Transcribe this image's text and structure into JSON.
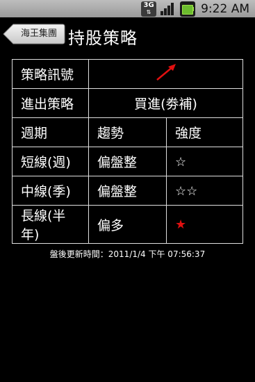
{
  "status_bar": {
    "network_label": "3G",
    "time": "9:22 AM"
  },
  "header": {
    "back_label": "海王集團",
    "title": "持股策略"
  },
  "strategy": {
    "signal_label": "策略訊號",
    "signal_icon": "red-up-right-arrow-icon",
    "signal_color": "#e01010",
    "entry_label": "進出策略",
    "entry_value": "買進(劵補)",
    "columns": {
      "period": "週期",
      "trend": "趨勢",
      "strength": "強度"
    },
    "rows": [
      {
        "period": "短線(週)",
        "trend": "偏盤整",
        "strength": "☆",
        "strength_count": 1,
        "filled": false
      },
      {
        "period": "中線(季)",
        "trend": "偏盤整",
        "strength": "☆☆",
        "strength_count": 2,
        "filled": false
      },
      {
        "period": "長線(半年)",
        "trend": "偏多",
        "strength": "★",
        "strength_count": 1,
        "filled": true
      }
    ]
  },
  "footer": {
    "update_text": "盤後更新時間：2011/1/4 下午 07:56:37"
  }
}
